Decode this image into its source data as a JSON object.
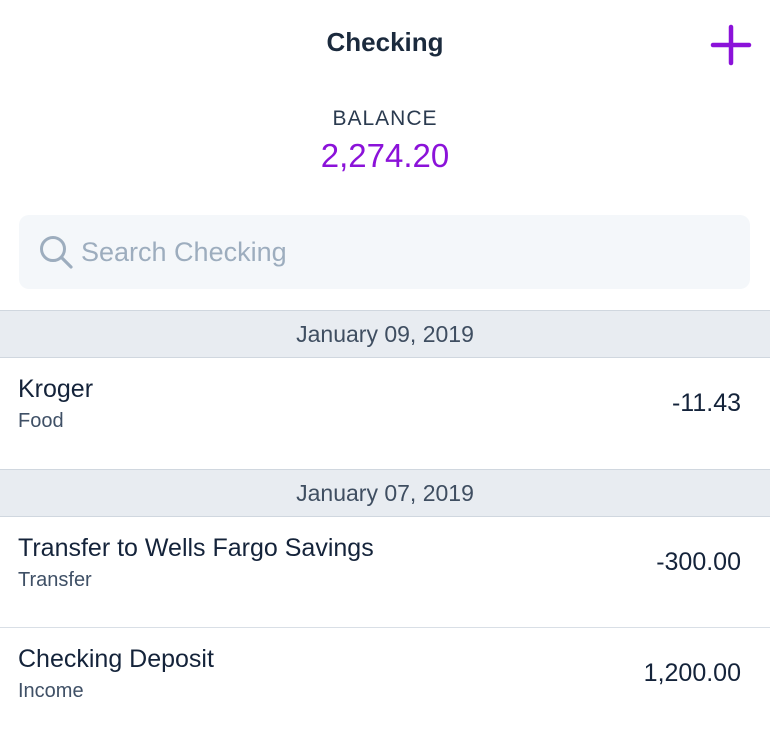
{
  "header": {
    "title": "Checking",
    "add_icon": "plus-icon",
    "accent_color": "#8b12d9"
  },
  "balance": {
    "label": "BALANCE",
    "value": "2,274.20"
  },
  "search": {
    "placeholder": "Search Checking",
    "value": "",
    "icon": "search-icon"
  },
  "sections": [
    {
      "date": "January 09, 2019",
      "transactions": [
        {
          "payee": "Kroger",
          "category": "Food",
          "amount": "-11.43"
        }
      ]
    },
    {
      "date": "January 07, 2019",
      "transactions": [
        {
          "payee": "Transfer to Wells Fargo Savings",
          "category": "Transfer",
          "amount": "-300.00"
        },
        {
          "payee": "Checking Deposit",
          "category": "Income",
          "amount": "1,200.00"
        }
      ]
    }
  ]
}
